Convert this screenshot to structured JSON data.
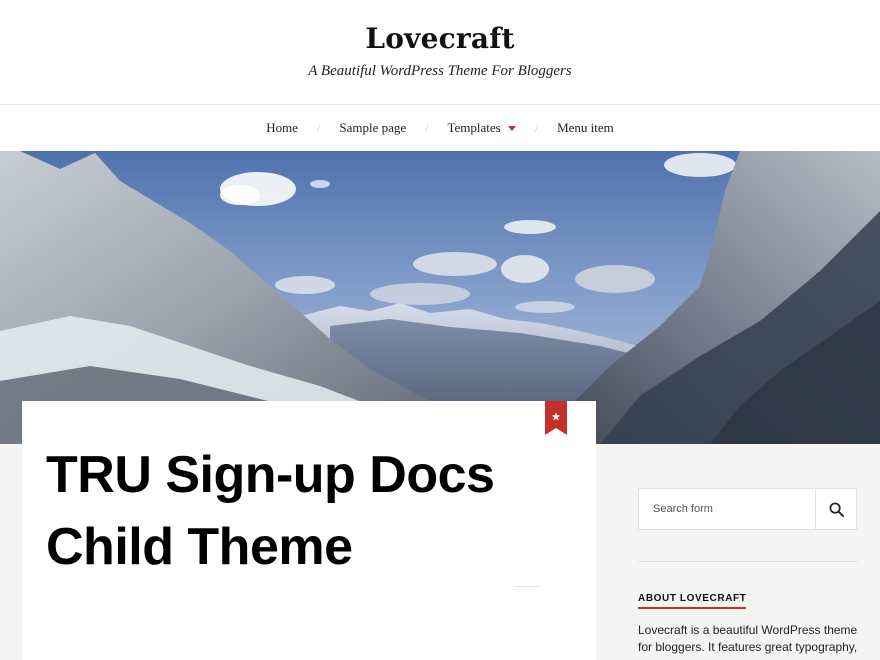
{
  "site": {
    "title": "Lovecraft",
    "tagline": "A Beautiful WordPress Theme For Bloggers"
  },
  "nav": {
    "items": [
      {
        "label": "Home"
      },
      {
        "label": "Sample page"
      },
      {
        "label": "Templates",
        "has_submenu": true
      },
      {
        "label": "Menu item"
      }
    ],
    "separator": "/"
  },
  "hero": {
    "image": "snowy-mountain-valley"
  },
  "post": {
    "title": "TRU Sign-up Docs Child Theme",
    "sticky_icon": "star-bookmark-icon"
  },
  "sidebar": {
    "search": {
      "placeholder": "Search form",
      "button_icon": "search-icon"
    },
    "about": {
      "title": "ABOUT LOVECRAFT",
      "text": "Lovecraft is a beautiful WordPress theme for bloggers. It features great typography,"
    }
  },
  "colors": {
    "accent": "#c4302b",
    "background": "#f4f4f4",
    "card": "#ffffff"
  }
}
